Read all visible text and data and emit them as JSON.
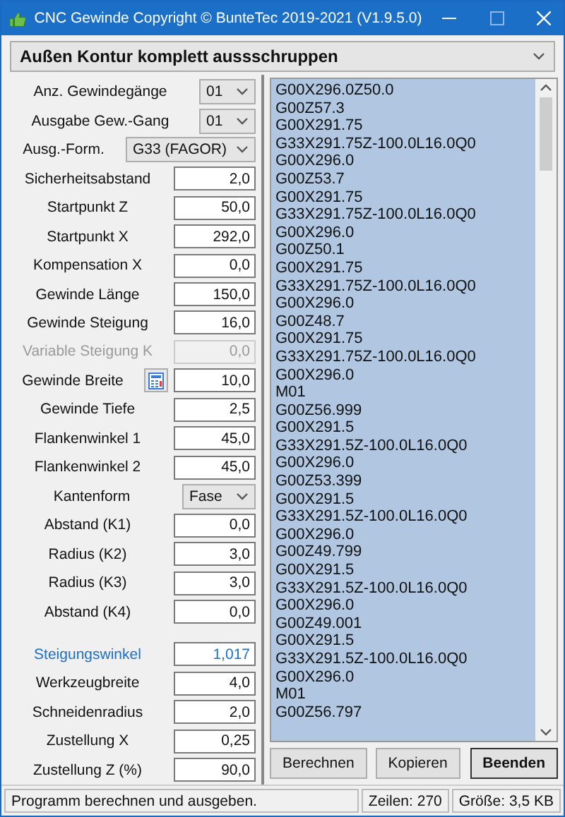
{
  "window": {
    "title": "CNC Gewinde Copyright © BunteTec 2019-2021 (V1.9.5.0)"
  },
  "mode_select": {
    "value": "Außen Kontur komplett aussschruppen"
  },
  "form": [
    {
      "kind": "select",
      "label": "Anz. Gewindegänge",
      "value": "01",
      "disabled": false,
      "highlight": false
    },
    {
      "kind": "select",
      "label": "Ausgabe Gew.-Gang",
      "value": "01",
      "disabled": false,
      "highlight": false
    },
    {
      "kind": "select-wide",
      "label": "Ausg.-Form.",
      "value": "G33 (FAGOR)",
      "disabled": false,
      "highlight": false
    },
    {
      "kind": "input",
      "label": "Sicherheitsabstand",
      "value": "2,0",
      "disabled": false,
      "highlight": false
    },
    {
      "kind": "input",
      "label": "Startpunkt Z",
      "value": "50,0",
      "disabled": false,
      "highlight": false
    },
    {
      "kind": "input",
      "label": "Startpunkt X",
      "value": "292,0",
      "disabled": false,
      "highlight": false
    },
    {
      "kind": "input",
      "label": "Kompensation X",
      "value": "0,0",
      "disabled": false,
      "highlight": false
    },
    {
      "kind": "input",
      "label": "Gewinde Länge",
      "value": "150,0",
      "disabled": false,
      "highlight": false
    },
    {
      "kind": "input",
      "label": "Gewinde Steigung",
      "value": "16,0",
      "disabled": false,
      "highlight": false
    },
    {
      "kind": "input",
      "label": "Variable Steigung K",
      "value": "0,0",
      "disabled": true,
      "highlight": false
    },
    {
      "kind": "input-tool",
      "label": "Gewinde Breite",
      "value": "10,0",
      "disabled": false,
      "highlight": false
    },
    {
      "kind": "input",
      "label": "Gewinde Tiefe",
      "value": "2,5",
      "disabled": false,
      "highlight": false
    },
    {
      "kind": "input",
      "label": "Flankenwinkel 1",
      "value": "45,0",
      "disabled": false,
      "highlight": false
    },
    {
      "kind": "input",
      "label": "Flankenwinkel 2",
      "value": "45,0",
      "disabled": false,
      "highlight": false
    },
    {
      "kind": "select",
      "label": "Kantenform",
      "value": "Fase",
      "disabled": false,
      "highlight": false
    },
    {
      "kind": "input",
      "label": "Abstand (K1)",
      "value": "0,0",
      "disabled": false,
      "highlight": false
    },
    {
      "kind": "input",
      "label": "Radius (K2)",
      "value": "3,0",
      "disabled": false,
      "highlight": false
    },
    {
      "kind": "input",
      "label": "Radius (K3)",
      "value": "3,0",
      "disabled": false,
      "highlight": false
    },
    {
      "kind": "input",
      "label": "Abstand (K4)",
      "value": "0,0",
      "disabled": false,
      "highlight": false
    },
    {
      "kind": "spacer"
    },
    {
      "kind": "input",
      "label": "Steigungswinkel",
      "value": "1,017",
      "disabled": false,
      "highlight": true
    },
    {
      "kind": "input",
      "label": "Werkzeugbreite",
      "value": "4,0",
      "disabled": false,
      "highlight": false
    },
    {
      "kind": "input",
      "label": "Schneidenradius",
      "value": "2,0",
      "disabled": false,
      "highlight": false
    },
    {
      "kind": "input",
      "label": "Zustellung X",
      "value": "0,25",
      "disabled": false,
      "highlight": false
    },
    {
      "kind": "input",
      "label": "Zustellung Z (%)",
      "value": "90,0",
      "disabled": false,
      "highlight": false
    }
  ],
  "code_output": {
    "selected": true,
    "lines": [
      "G00X296.0Z50.0",
      "G00Z57.3",
      "G00X291.75",
      "G33X291.75Z-100.0L16.0Q0",
      "G00X296.0",
      "G00Z53.7",
      "G00X291.75",
      "G33X291.75Z-100.0L16.0Q0",
      "G00X296.0",
      "G00Z50.1",
      "G00X291.75",
      "G33X291.75Z-100.0L16.0Q0",
      "G00X296.0",
      "G00Z48.7",
      "G00X291.75",
      "G33X291.75Z-100.0L16.0Q0",
      "G00X296.0",
      "M01",
      "G00Z56.999",
      "G00X291.5",
      "G33X291.5Z-100.0L16.0Q0",
      "G00X296.0",
      "G00Z53.399",
      "G00X291.5",
      "G33X291.5Z-100.0L16.0Q0",
      "G00X296.0",
      "G00Z49.799",
      "G00X291.5",
      "G33X291.5Z-100.0L16.0Q0",
      "G00X296.0",
      "G00Z49.001",
      "G00X291.5",
      "G33X291.5Z-100.0L16.0Q0",
      "G00X296.0",
      "M01",
      "G00Z56.797"
    ]
  },
  "buttons": [
    {
      "label": "Berechnen",
      "bold": false
    },
    {
      "label": "Kopieren",
      "bold": false
    },
    {
      "label": "Beenden",
      "bold": true
    }
  ],
  "status_bar": {
    "message": "Programm berechnen und ausgeben.",
    "lines": "Zeilen: 270",
    "size": "Größe: 3,5 KB"
  }
}
